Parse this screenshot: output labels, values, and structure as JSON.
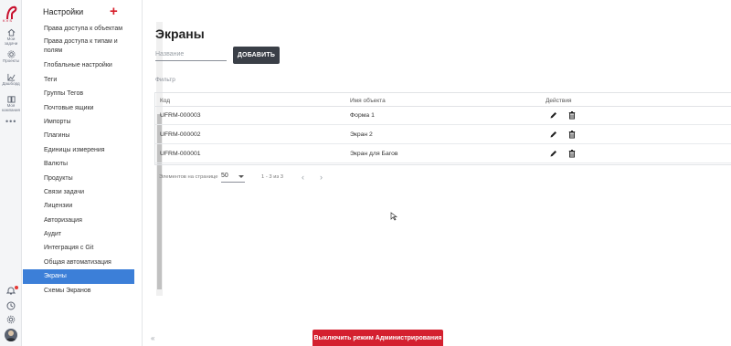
{
  "rail": {
    "logo_text": "KVS",
    "items": [
      {
        "label": "Мои задачи",
        "icon": "home-icon"
      },
      {
        "label": "Проекты",
        "icon": "gear-icon"
      },
      {
        "label": "Дашборд",
        "icon": "chart-icon"
      },
      {
        "label": "Моя компания",
        "icon": "book-icon"
      }
    ],
    "more": "•••",
    "bottom_icons": [
      "bell-icon",
      "history-icon",
      "settings-icon",
      "avatar"
    ]
  },
  "sidebar": {
    "title": "Настройки",
    "add_label": "+",
    "items": [
      {
        "label": "Права доступа к объектам"
      },
      {
        "label": "Права доступа к типам и полям"
      },
      {
        "label": "Глобальные настройки"
      },
      {
        "label": "Теги"
      },
      {
        "label": "Группы Тегов"
      },
      {
        "label": "Почтовые ящики"
      },
      {
        "label": "Импорты"
      },
      {
        "label": "Плагины"
      },
      {
        "label": "Единицы измерения"
      },
      {
        "label": "Валюты"
      },
      {
        "label": "Продукты"
      },
      {
        "label": "Связи задачи"
      },
      {
        "label": "Лицензии"
      },
      {
        "label": "Авторизация"
      },
      {
        "label": "Аудит"
      },
      {
        "label": "Интеграция с Git"
      },
      {
        "label": "Общая автоматизация"
      },
      {
        "label": "Экраны"
      },
      {
        "label": "Схемы Экранов"
      }
    ],
    "active_index": 17,
    "collapse_label": "«"
  },
  "main": {
    "title": "Экраны",
    "name_placeholder": "Название",
    "add_button": "ДОБАВИТЬ",
    "filter_label": "Фильтр",
    "table": {
      "headers": [
        "Код",
        "Имя объекта",
        "Действия"
      ],
      "rows": [
        {
          "code": "UFRM-000003",
          "name": "Форма 1"
        },
        {
          "code": "UFRM-000002",
          "name": "Экран 2"
        },
        {
          "code": "UFRM-000001",
          "name": "Экран для Багов"
        }
      ]
    },
    "pager": {
      "per_page_label": "Элементов на странице",
      "per_page_value": "50",
      "range": "1 - 3 из 3",
      "prev": "‹",
      "next": "›"
    },
    "admin_button": "Выключить режим Администрирования"
  },
  "colors": {
    "accent": "#d4202f",
    "active_item": "#3c7fd8",
    "button_dark": "#3a3f47"
  }
}
